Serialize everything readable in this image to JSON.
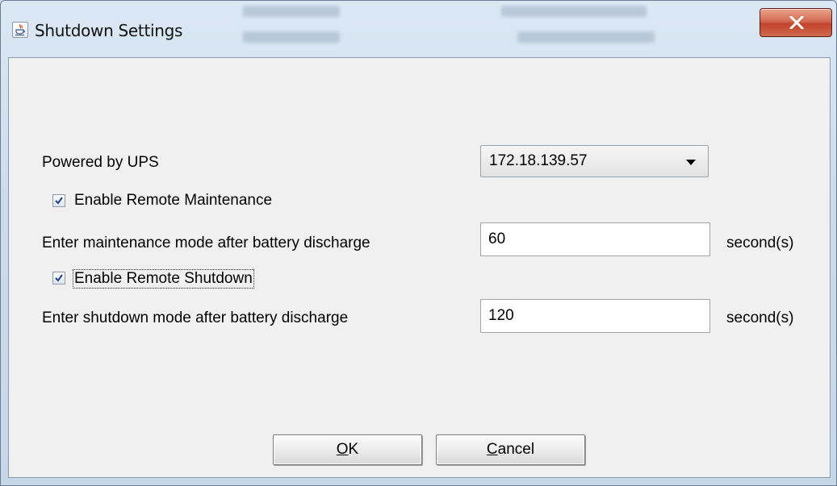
{
  "window": {
    "title": "Shutdown Settings",
    "title_icon": "java-cup-icon",
    "close_icon": "close-icon"
  },
  "form": {
    "powered_by_label": "Powered by UPS",
    "ups_selected": "172.18.139.57",
    "enable_maintenance_label": "Enable Remote Maintenance",
    "enable_maintenance_checked": true,
    "maintenance_delay_label": "Enter maintenance mode after battery discharge",
    "maintenance_delay_value": "60",
    "maintenance_unit": "second(s)",
    "enable_shutdown_label": "Enable Remote Shutdown",
    "enable_shutdown_checked": true,
    "shutdown_delay_label": "Enter shutdown mode after battery discharge",
    "shutdown_delay_value": "120",
    "shutdown_unit": "second(s)"
  },
  "buttons": {
    "ok_mnemonic": "O",
    "ok_rest": "K",
    "cancel_mnemonic": "C",
    "cancel_rest": "ancel"
  },
  "colors": {
    "dialog_bg": "#f0f0f0",
    "frame_bg": "#cddcec",
    "close_button": "#c1442b"
  }
}
